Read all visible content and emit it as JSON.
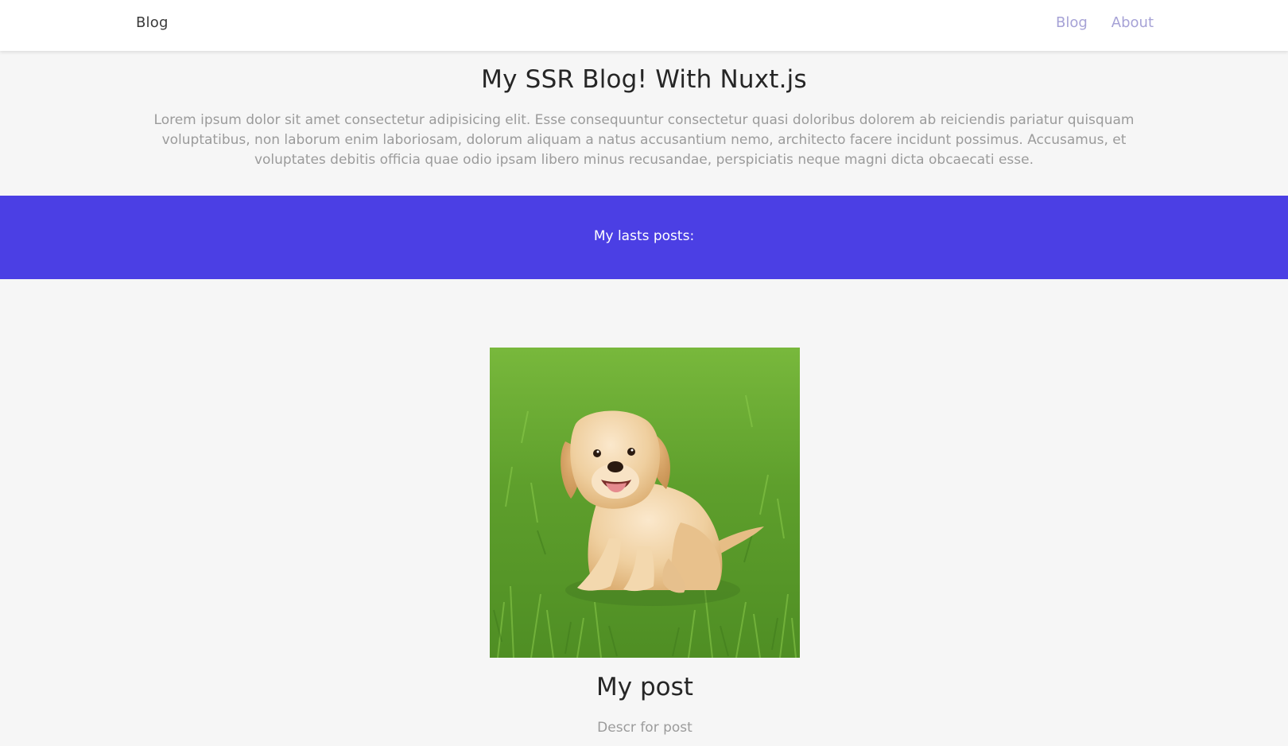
{
  "nav": {
    "brand": "Blog",
    "links": [
      {
        "label": "Blog"
      },
      {
        "label": "About"
      }
    ]
  },
  "hero": {
    "title": "My SSR Blog! With Nuxt.js",
    "description": "Lorem ipsum dolor sit amet consectetur adipisicing elit. Esse consequuntur consectetur quasi doloribus dolorem ab reiciendis pariatur quisquam voluptatibus, non laborum enim laboriosam, dolorum aliquam a natus accusantium nemo, architecto facere incidunt possimus. Accusamus, et voluptates debitis officia quae odio ipsam libero minus recusandae, perspiciatis neque magni dicta obcaecati esse."
  },
  "posts_section": {
    "heading": "My lasts posts:"
  },
  "posts": [
    {
      "title": "My post",
      "description": "Descr for post"
    }
  ],
  "colors": {
    "accent_band": "#4b3fe4",
    "nav_link": "#a6a2d6",
    "page_bg": "#f6f6f6"
  }
}
